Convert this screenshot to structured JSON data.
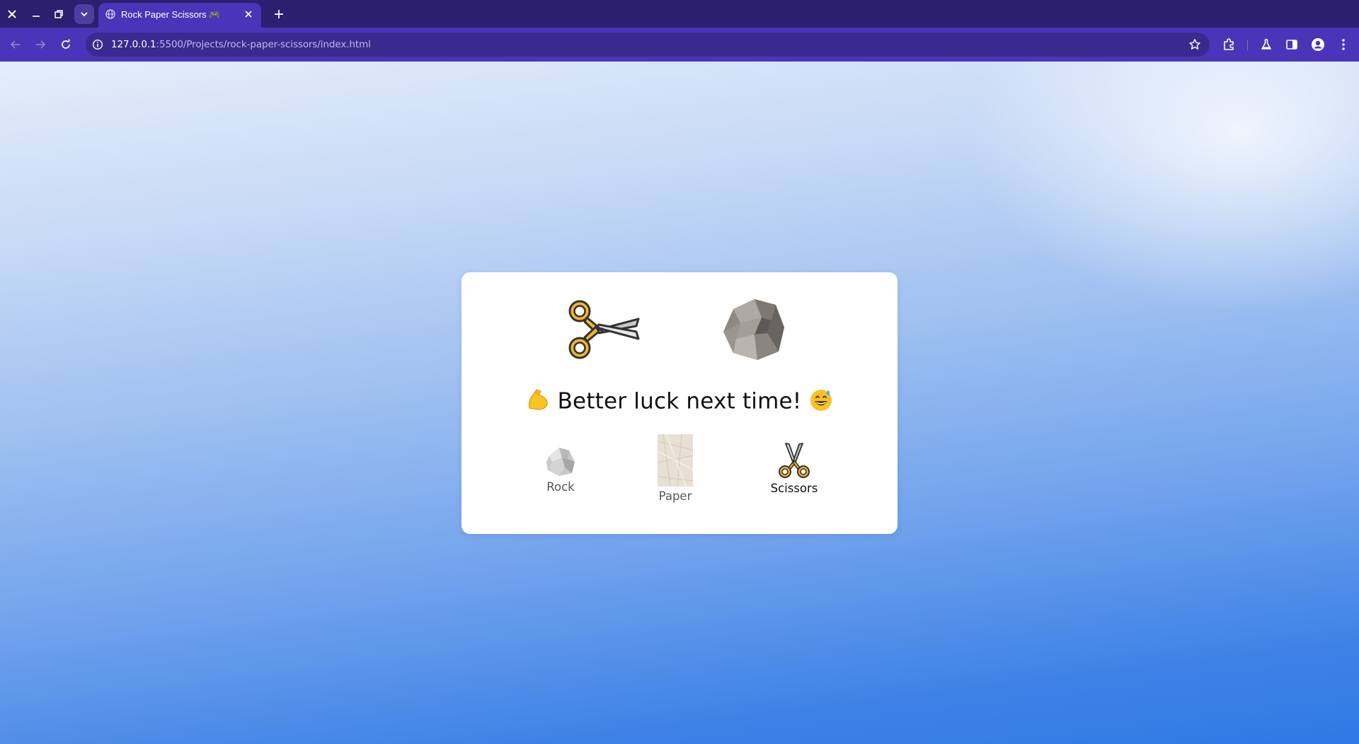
{
  "browser": {
    "tab_title": "Rock Paper Scissors 🎮",
    "url_host": "127.0.0.1",
    "url_rest": ":5500/Projects/rock-paper-scissors/index.html"
  },
  "game": {
    "player_hand": "scissors",
    "computer_hand": "rock",
    "result_prefix_emoji": "💪",
    "result_text": "Better luck next time!",
    "result_suffix_emoji": "😅",
    "choices": [
      {
        "label": "Rock",
        "icon": "rock-icon",
        "selected": false
      },
      {
        "label": "Paper",
        "icon": "paper-icon",
        "selected": false
      },
      {
        "label": "Scissors",
        "icon": "scissors-icon",
        "selected": true
      }
    ]
  },
  "colors": {
    "tab_strip": "#2d1f6f",
    "toolbar": "#4a35b8",
    "omnibox": "#3a2a8f",
    "card": "#ffffff",
    "scissors_handle": "#f5b52c"
  }
}
